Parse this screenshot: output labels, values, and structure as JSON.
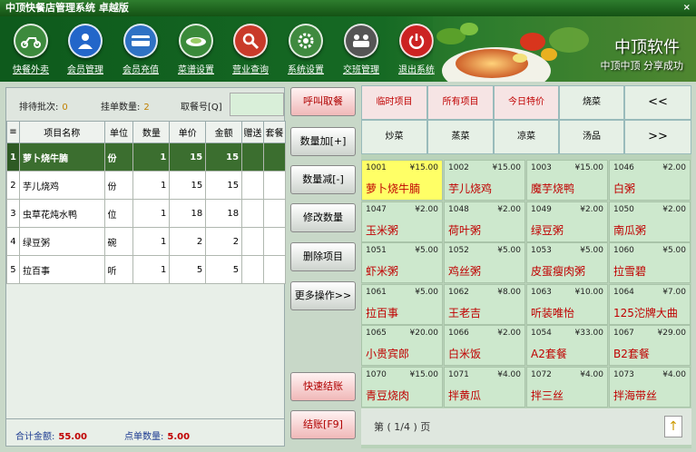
{
  "window": {
    "title": "中顶快餐店管理系统  卓越版",
    "close": "×"
  },
  "toolbar": {
    "items": [
      {
        "label": "快餐外卖",
        "icon": "scooter-icon",
        "color": "#3d8a3d"
      },
      {
        "label": "会员管理",
        "icon": "user-icon",
        "color": "#2366c9"
      },
      {
        "label": "会员充值",
        "icon": "card-icon",
        "color": "#2f72c4"
      },
      {
        "label": "菜谱设置",
        "icon": "dish-icon",
        "color": "#3a8a3a"
      },
      {
        "label": "营业查询",
        "icon": "search-icon",
        "color": "#c93a2a"
      },
      {
        "label": "系统设置",
        "icon": "gear-icon",
        "color": "#3f8a3f"
      },
      {
        "label": "交班管理",
        "icon": "people-icon",
        "color": "#555555"
      },
      {
        "label": "退出系统",
        "icon": "power-icon",
        "color": "#cc2222"
      }
    ],
    "brand": "中顶软件",
    "slogan": "中顶中顶 分享成功"
  },
  "info": {
    "waiting_label": "排待批次:",
    "waiting_value": "0",
    "hold_label": "挂单数量:",
    "hold_value": "2",
    "ticket_label": "取餐号[Q]",
    "ticket_value": ""
  },
  "order": {
    "headers": [
      "项目名称",
      "单位",
      "数量",
      "单价",
      "金额",
      "赠送",
      "套餐"
    ],
    "rows": [
      {
        "no": "1",
        "name": "萝卜烧牛腩",
        "unit": "份",
        "qty": "1",
        "price": "15",
        "amount": "15"
      },
      {
        "no": "2",
        "name": "芋儿烧鸡",
        "unit": "份",
        "qty": "1",
        "price": "15",
        "amount": "15"
      },
      {
        "no": "3",
        "name": "虫草花炖水鸭",
        "unit": "位",
        "qty": "1",
        "price": "18",
        "amount": "18"
      },
      {
        "no": "4",
        "name": "绿豆粥",
        "unit": "碗",
        "qty": "1",
        "price": "2",
        "amount": "2"
      },
      {
        "no": "5",
        "name": "拉百事",
        "unit": "听",
        "qty": "1",
        "price": "5",
        "amount": "5"
      }
    ]
  },
  "totals": {
    "amount_label": "合计金额:",
    "amount_value": "55.00",
    "count_label": "点单数量:",
    "count_value": "5.00"
  },
  "actions": {
    "call": "呼叫取餐",
    "qty_add": "数量加[+]",
    "qty_sub": "数量减[-]",
    "edit_qty": "修改数量",
    "delete_item": "删除项目",
    "more": "更多操作>>",
    "quick_checkout": "快速结账",
    "checkout": "结账[F9]"
  },
  "categories": {
    "row1": [
      "临时项目",
      "所有项目",
      "今日特价",
      "烧菜",
      "<<"
    ],
    "row2": [
      "炒菜",
      "蒸菜",
      "凉菜",
      "汤品",
      ">>"
    ]
  },
  "dishes": [
    {
      "code": "1001",
      "price": "¥15.00",
      "name": "萝卜烧牛腩"
    },
    {
      "code": "1002",
      "price": "¥15.00",
      "name": "芋儿烧鸡"
    },
    {
      "code": "1003",
      "price": "¥15.00",
      "name": "魔芋烧鸭"
    },
    {
      "code": "1046",
      "price": "¥2.00",
      "name": "白粥"
    },
    {
      "code": "1047",
      "price": "¥2.00",
      "name": "玉米粥"
    },
    {
      "code": "1048",
      "price": "¥2.00",
      "name": "荷叶粥"
    },
    {
      "code": "1049",
      "price": "¥2.00",
      "name": "绿豆粥"
    },
    {
      "code": "1050",
      "price": "¥2.00",
      "name": "南瓜粥"
    },
    {
      "code": "1051",
      "price": "¥5.00",
      "name": "虾米粥"
    },
    {
      "code": "1052",
      "price": "¥5.00",
      "name": "鸡丝粥"
    },
    {
      "code": "1053",
      "price": "¥5.00",
      "name": "皮蛋瘦肉粥"
    },
    {
      "code": "1060",
      "price": "¥5.00",
      "name": "拉雪碧"
    },
    {
      "code": "1061",
      "price": "¥5.00",
      "name": "拉百事"
    },
    {
      "code": "1062",
      "price": "¥8.00",
      "name": "王老吉"
    },
    {
      "code": "1063",
      "price": "¥10.00",
      "name": "听装唯怡"
    },
    {
      "code": "1064",
      "price": "¥7.00",
      "name": "125沱牌大曲"
    },
    {
      "code": "1065",
      "price": "¥20.00",
      "name": "小贵宾郎"
    },
    {
      "code": "1066",
      "price": "¥2.00",
      "name": "白米饭"
    },
    {
      "code": "1054",
      "price": "¥33.00",
      "name": "A2套餐"
    },
    {
      "code": "1067",
      "price": "¥29.00",
      "name": "B2套餐"
    },
    {
      "code": "1070",
      "price": "¥15.00",
      "name": "青豆烧肉"
    },
    {
      "code": "1071",
      "price": "¥4.00",
      "name": "拌黄瓜"
    },
    {
      "code": "1072",
      "price": "¥4.00",
      "name": "拌三丝"
    },
    {
      "code": "1073",
      "price": "¥4.00",
      "name": "拌海带丝"
    }
  ],
  "pager": {
    "text": "第  ( 1/4 )  页",
    "up": "↑"
  }
}
